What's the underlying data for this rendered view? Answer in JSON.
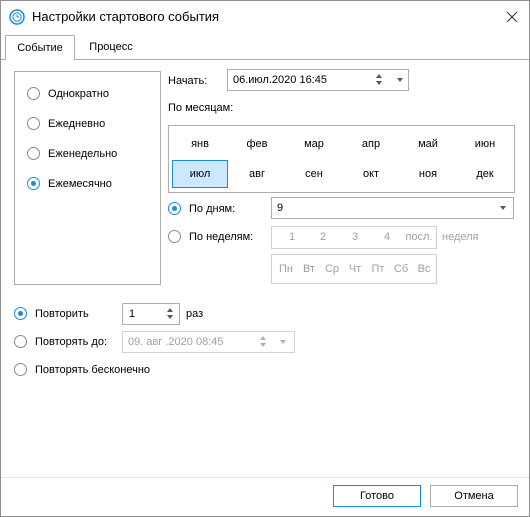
{
  "window": {
    "title": "Настройки стартового события",
    "accent": "#1a8cd8"
  },
  "tabs": [
    {
      "label": "Событие",
      "active": true
    },
    {
      "label": "Процесс",
      "active": false
    }
  ],
  "frequency": {
    "options": [
      "Однократно",
      "Ежедневно",
      "Еженедельно",
      "Ежемесячно"
    ],
    "selected": "Ежемесячно"
  },
  "start": {
    "label": "Начать:",
    "value": "06.июл.2020 16:45"
  },
  "months": {
    "label": "По месяцам:",
    "items": [
      "янв",
      "фев",
      "мар",
      "апр",
      "май",
      "июн",
      "июл",
      "авг",
      "сен",
      "окт",
      "ноя",
      "дек"
    ],
    "selected": "июл"
  },
  "by_days": {
    "label": "По дням:",
    "value": "9",
    "selected": true
  },
  "by_weeks": {
    "label": "По неделям:",
    "weeks": [
      "1",
      "2",
      "3",
      "4",
      "посл."
    ],
    "suffix": "неделя",
    "weekdays": [
      "Пн",
      "Вт",
      "Ср",
      "Чт",
      "Пт",
      "Сб",
      "Вс"
    ],
    "selected": false
  },
  "repeat": {
    "times_label": "Повторить",
    "times_value": "1",
    "times_unit": "раз",
    "until_label": "Повторять до:",
    "until_value": "09. авг .2020 08:45",
    "forever_label": "Повторять бесконечно",
    "selected": "times"
  },
  "buttons": {
    "ok": "Готово",
    "cancel": "Отмена"
  }
}
